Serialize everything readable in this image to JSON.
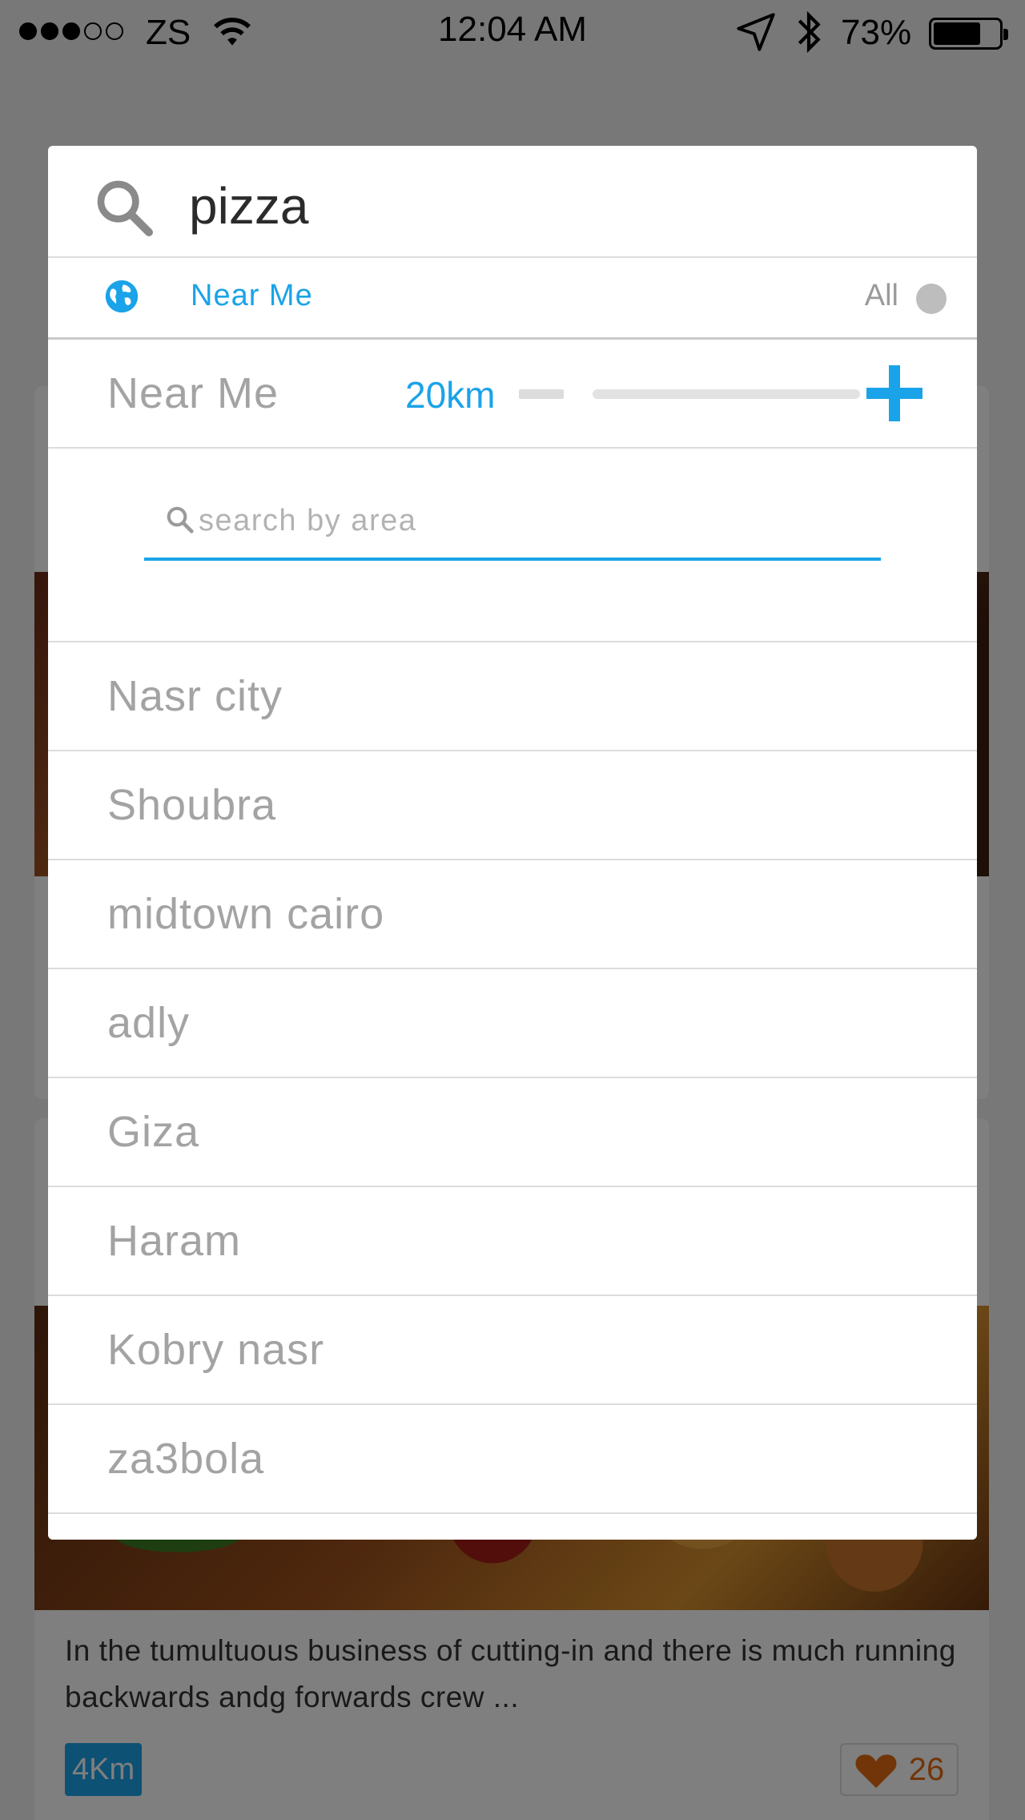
{
  "status_bar": {
    "carrier": "ZS",
    "time": "12:04 AM",
    "battery_percent": "73%",
    "signal_bars_filled": 3,
    "signal_bars_total": 5,
    "battery_level": 0.73
  },
  "search": {
    "query": "pizza",
    "icon": "search-icon"
  },
  "filter": {
    "near_me_label": "Near Me",
    "all_label": "All",
    "icon": "globe-icon",
    "accent_color": "#1aa3e8"
  },
  "range": {
    "label": "Near Me",
    "value_label": "20km",
    "slider_level": 0.0
  },
  "area_search": {
    "placeholder": "search by area",
    "value": ""
  },
  "areas": [
    "Nasr city",
    "Shoubra",
    "midtown cairo",
    "adly",
    "Giza",
    "Haram",
    "Kobry nasr",
    "za3bola"
  ],
  "background_card": {
    "description": "In the tumultuous business of cutting-in and there is much running backwards andg forwards crew ...",
    "distance": "4Km",
    "likes": "26"
  }
}
